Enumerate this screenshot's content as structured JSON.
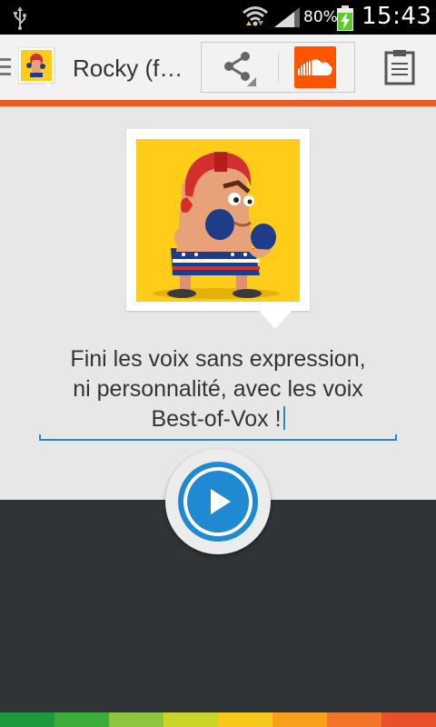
{
  "status_bar": {
    "battery_percent": "80%",
    "time": "15:43",
    "icons": [
      "usb-icon",
      "wifi-icon",
      "signal-icon",
      "battery-charging-icon"
    ]
  },
  "action_bar": {
    "title": "Rocky (f…",
    "icons": [
      "app-icon",
      "share-icon",
      "soundcloud-icon",
      "clipboard-icon"
    ]
  },
  "main": {
    "tagline_line1": "Fini les voix sans expression,",
    "tagline_line2": "ni personnalité, avec les voix",
    "tagline_line3": "Best-of-Vox !",
    "play_icon": "play-icon"
  },
  "colors": {
    "accent": "#ea5b25",
    "play_blue": "#1f8ad2",
    "soundcloud": "#ff5500",
    "portrait_bg": "#ffcc1a",
    "strip": [
      "#1c9a3c",
      "#3cad3a",
      "#8cc63f",
      "#c9d629",
      "#f5c81a",
      "#f7a11a",
      "#f2762a",
      "#e6512a"
    ]
  }
}
